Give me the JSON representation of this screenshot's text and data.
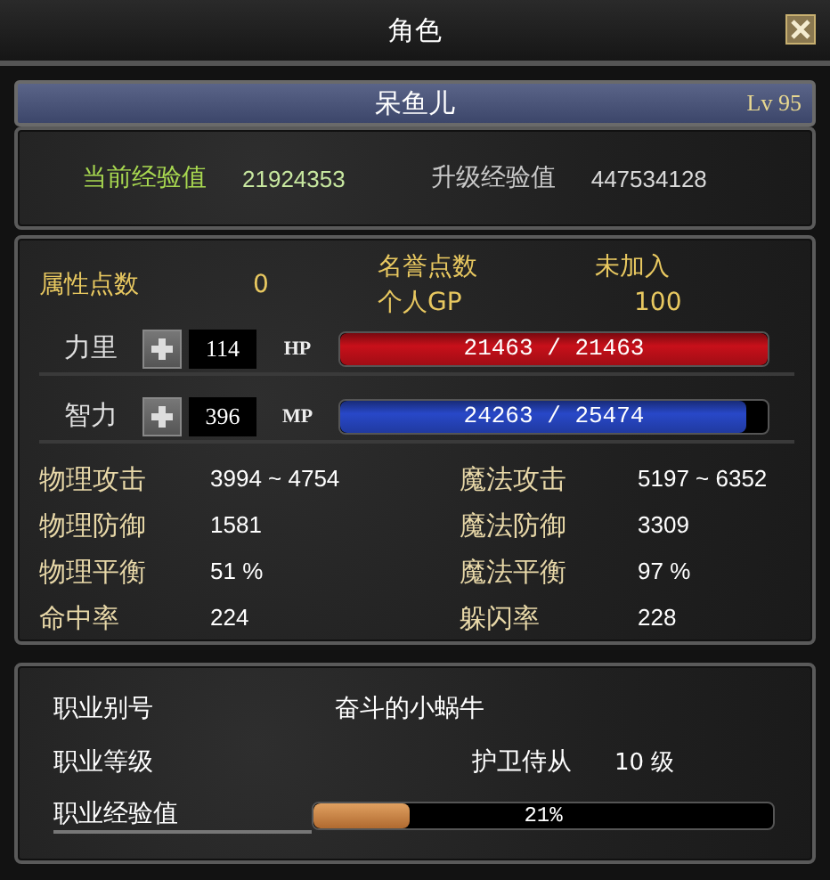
{
  "window": {
    "title": "角色"
  },
  "character": {
    "name": "呆鱼儿",
    "level": "Lv 95"
  },
  "experience": [
    {
      "label": "当前经验值",
      "value": "21924353",
      "kind": "current"
    },
    {
      "label": "升级经验值",
      "value": "447534128",
      "kind": "next"
    }
  ],
  "points": {
    "label": "属性点数",
    "value": "0",
    "honor_label": "名誉点数",
    "honor_value": "未加入",
    "gp_label": "个人GP",
    "gp_value": "100"
  },
  "attributes": [
    {
      "label": "力里",
      "value": "114",
      "bar_label": "HP",
      "reading": "21463 / 21463",
      "level": 1.0,
      "color": "#c8101a"
    },
    {
      "label": "智力",
      "value": "396",
      "bar_label": "MP",
      "reading": "24263 / 25474",
      "level": 0.95,
      "color": "#2848c8"
    }
  ],
  "stats": [
    {
      "label": "物理攻击",
      "value": "3994 ~ 4754"
    },
    {
      "label": "魔法攻击",
      "value": "5197 ~ 6352"
    },
    {
      "label": "物理防御",
      "value": "1581"
    },
    {
      "label": "魔法防御",
      "value": "3309"
    },
    {
      "label": "物理平衡",
      "value": "51 %"
    },
    {
      "label": "魔法平衡",
      "value": "97 %"
    },
    {
      "label": "命中率",
      "value": "224"
    },
    {
      "label": "躲闪率",
      "value": "228"
    }
  ],
  "job": {
    "title_label": "职业别号",
    "title": "奋斗的小蜗牛",
    "rank_label": "职业等级",
    "rank": "护卫侍从",
    "rank_level": "10 级",
    "exp_label": "职业经验值",
    "level": 0.21,
    "reading": "21%"
  }
}
